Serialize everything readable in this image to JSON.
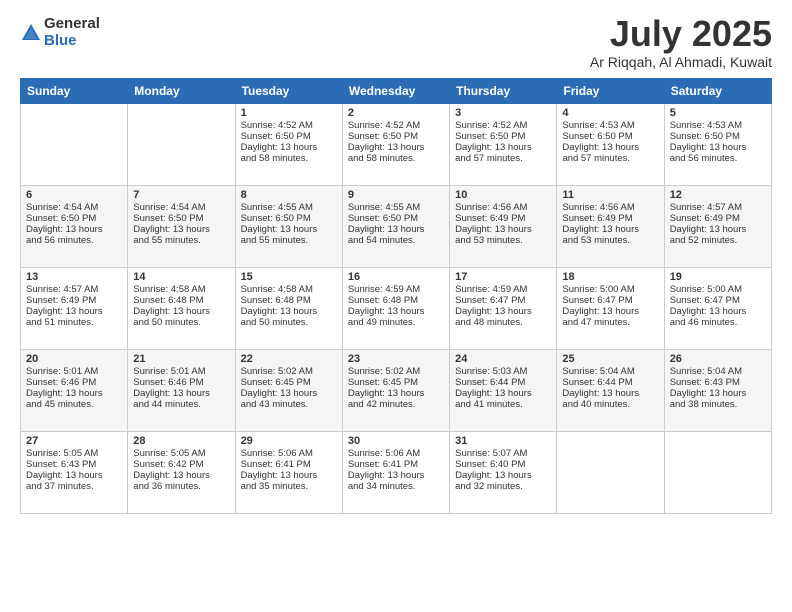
{
  "logo": {
    "general": "General",
    "blue": "Blue"
  },
  "title": "July 2025",
  "location": "Ar Riqqah, Al Ahmadi, Kuwait",
  "days_of_week": [
    "Sunday",
    "Monday",
    "Tuesday",
    "Wednesday",
    "Thursday",
    "Friday",
    "Saturday"
  ],
  "weeks": [
    [
      {
        "day": "",
        "content": ""
      },
      {
        "day": "",
        "content": ""
      },
      {
        "day": "1",
        "content": "Sunrise: 4:52 AM\nSunset: 6:50 PM\nDaylight: 13 hours\nand 58 minutes."
      },
      {
        "day": "2",
        "content": "Sunrise: 4:52 AM\nSunset: 6:50 PM\nDaylight: 13 hours\nand 58 minutes."
      },
      {
        "day": "3",
        "content": "Sunrise: 4:52 AM\nSunset: 6:50 PM\nDaylight: 13 hours\nand 57 minutes."
      },
      {
        "day": "4",
        "content": "Sunrise: 4:53 AM\nSunset: 6:50 PM\nDaylight: 13 hours\nand 57 minutes."
      },
      {
        "day": "5",
        "content": "Sunrise: 4:53 AM\nSunset: 6:50 PM\nDaylight: 13 hours\nand 56 minutes."
      }
    ],
    [
      {
        "day": "6",
        "content": "Sunrise: 4:54 AM\nSunset: 6:50 PM\nDaylight: 13 hours\nand 56 minutes."
      },
      {
        "day": "7",
        "content": "Sunrise: 4:54 AM\nSunset: 6:50 PM\nDaylight: 13 hours\nand 55 minutes."
      },
      {
        "day": "8",
        "content": "Sunrise: 4:55 AM\nSunset: 6:50 PM\nDaylight: 13 hours\nand 55 minutes."
      },
      {
        "day": "9",
        "content": "Sunrise: 4:55 AM\nSunset: 6:50 PM\nDaylight: 13 hours\nand 54 minutes."
      },
      {
        "day": "10",
        "content": "Sunrise: 4:56 AM\nSunset: 6:49 PM\nDaylight: 13 hours\nand 53 minutes."
      },
      {
        "day": "11",
        "content": "Sunrise: 4:56 AM\nSunset: 6:49 PM\nDaylight: 13 hours\nand 53 minutes."
      },
      {
        "day": "12",
        "content": "Sunrise: 4:57 AM\nSunset: 6:49 PM\nDaylight: 13 hours\nand 52 minutes."
      }
    ],
    [
      {
        "day": "13",
        "content": "Sunrise: 4:57 AM\nSunset: 6:49 PM\nDaylight: 13 hours\nand 51 minutes."
      },
      {
        "day": "14",
        "content": "Sunrise: 4:58 AM\nSunset: 6:48 PM\nDaylight: 13 hours\nand 50 minutes."
      },
      {
        "day": "15",
        "content": "Sunrise: 4:58 AM\nSunset: 6:48 PM\nDaylight: 13 hours\nand 50 minutes."
      },
      {
        "day": "16",
        "content": "Sunrise: 4:59 AM\nSunset: 6:48 PM\nDaylight: 13 hours\nand 49 minutes."
      },
      {
        "day": "17",
        "content": "Sunrise: 4:59 AM\nSunset: 6:47 PM\nDaylight: 13 hours\nand 48 minutes."
      },
      {
        "day": "18",
        "content": "Sunrise: 5:00 AM\nSunset: 6:47 PM\nDaylight: 13 hours\nand 47 minutes."
      },
      {
        "day": "19",
        "content": "Sunrise: 5:00 AM\nSunset: 6:47 PM\nDaylight: 13 hours\nand 46 minutes."
      }
    ],
    [
      {
        "day": "20",
        "content": "Sunrise: 5:01 AM\nSunset: 6:46 PM\nDaylight: 13 hours\nand 45 minutes."
      },
      {
        "day": "21",
        "content": "Sunrise: 5:01 AM\nSunset: 6:46 PM\nDaylight: 13 hours\nand 44 minutes."
      },
      {
        "day": "22",
        "content": "Sunrise: 5:02 AM\nSunset: 6:45 PM\nDaylight: 13 hours\nand 43 minutes."
      },
      {
        "day": "23",
        "content": "Sunrise: 5:02 AM\nSunset: 6:45 PM\nDaylight: 13 hours\nand 42 minutes."
      },
      {
        "day": "24",
        "content": "Sunrise: 5:03 AM\nSunset: 6:44 PM\nDaylight: 13 hours\nand 41 minutes."
      },
      {
        "day": "25",
        "content": "Sunrise: 5:04 AM\nSunset: 6:44 PM\nDaylight: 13 hours\nand 40 minutes."
      },
      {
        "day": "26",
        "content": "Sunrise: 5:04 AM\nSunset: 6:43 PM\nDaylight: 13 hours\nand 38 minutes."
      }
    ],
    [
      {
        "day": "27",
        "content": "Sunrise: 5:05 AM\nSunset: 6:43 PM\nDaylight: 13 hours\nand 37 minutes."
      },
      {
        "day": "28",
        "content": "Sunrise: 5:05 AM\nSunset: 6:42 PM\nDaylight: 13 hours\nand 36 minutes."
      },
      {
        "day": "29",
        "content": "Sunrise: 5:06 AM\nSunset: 6:41 PM\nDaylight: 13 hours\nand 35 minutes."
      },
      {
        "day": "30",
        "content": "Sunrise: 5:06 AM\nSunset: 6:41 PM\nDaylight: 13 hours\nand 34 minutes."
      },
      {
        "day": "31",
        "content": "Sunrise: 5:07 AM\nSunset: 6:40 PM\nDaylight: 13 hours\nand 32 minutes."
      },
      {
        "day": "",
        "content": ""
      },
      {
        "day": "",
        "content": ""
      }
    ]
  ]
}
